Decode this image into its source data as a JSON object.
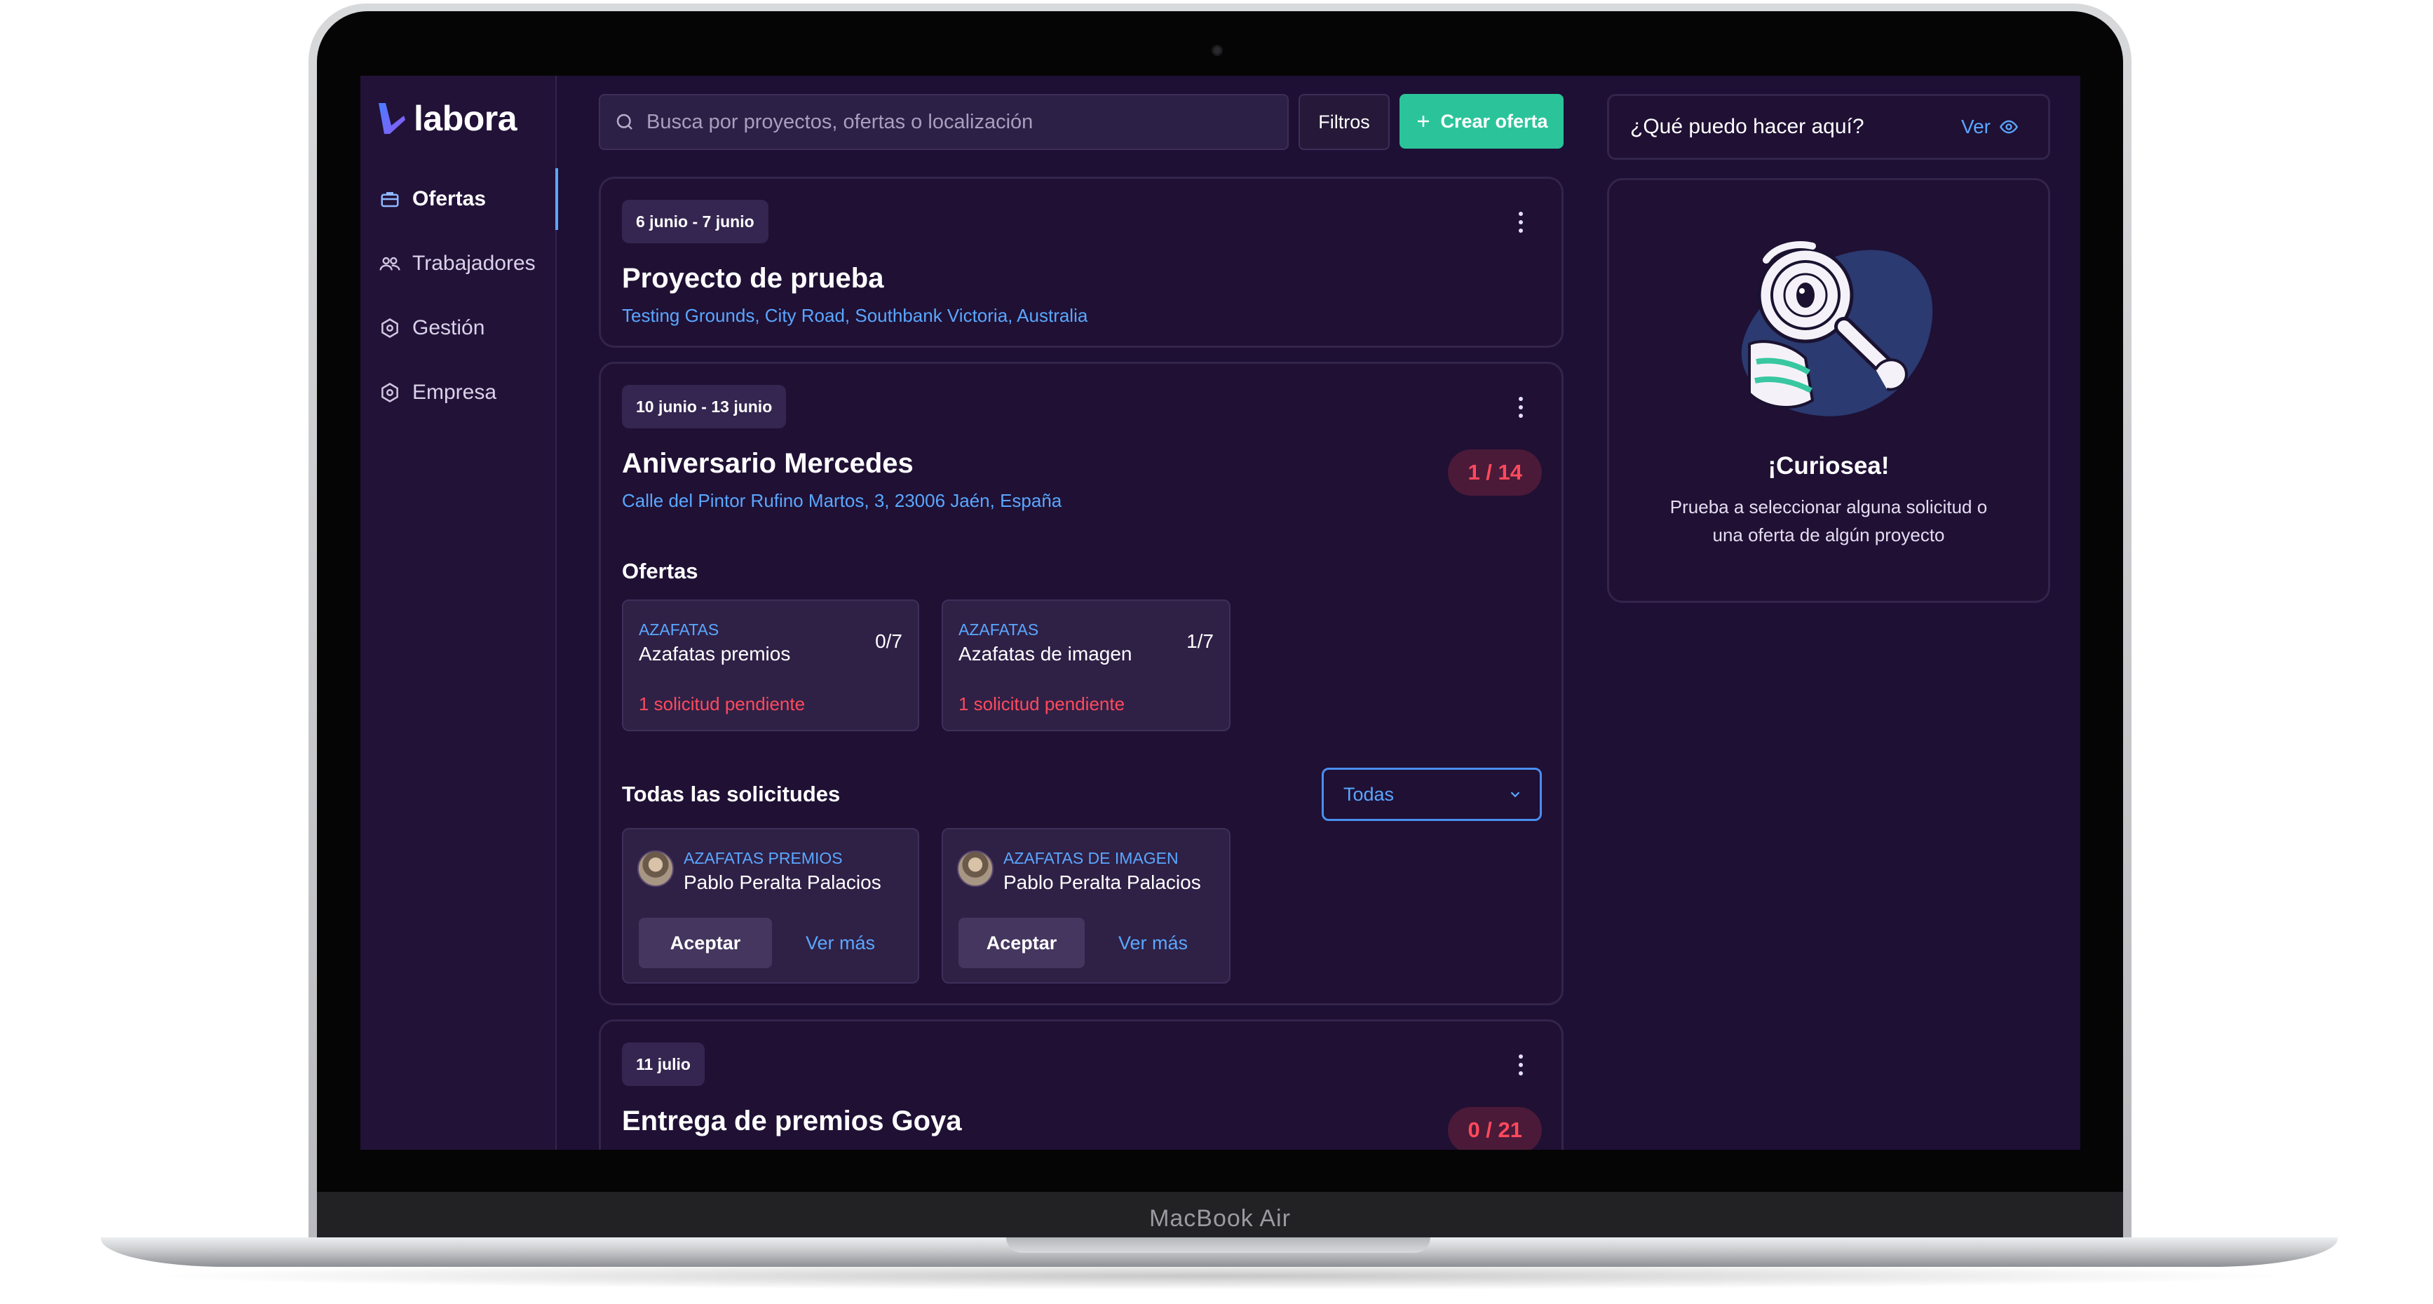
{
  "device": {
    "brand_label": "MacBook Air"
  },
  "app": {
    "logo_text": "labora"
  },
  "sidebar": {
    "items": [
      {
        "label": "Ofertas",
        "icon": "briefcase-icon",
        "active": true
      },
      {
        "label": "Trabajadores",
        "icon": "users-icon",
        "active": false
      },
      {
        "label": "Gestión",
        "icon": "gear-icon",
        "active": false
      },
      {
        "label": "Empresa",
        "icon": "gear-icon",
        "active": false
      }
    ]
  },
  "toolbar": {
    "search_placeholder": "Busca por proyectos, ofertas o localización",
    "filters_label": "Filtros",
    "create_label": "Crear oferta"
  },
  "projects": [
    {
      "date": "6 junio - 7 junio",
      "title": "Proyecto de prueba",
      "location": "Testing Grounds, City Road, Southbank Victoria, Australia"
    },
    {
      "date": "10 junio - 13 junio",
      "title": "Aniversario Mercedes",
      "location": "Calle del Pintor Rufino Martos, 3, 23006 Jaén, España",
      "count": "1 / 14",
      "offers_title": "Ofertas",
      "offers": [
        {
          "category": "AZAFATAS",
          "name": "Azafatas premios",
          "count": "0/7",
          "pending": "1 solicitud pendiente"
        },
        {
          "category": "AZAFATAS",
          "name": "Azafatas de imagen",
          "count": "1/7",
          "pending": "1 solicitud pendiente"
        }
      ],
      "requests_title": "Todas las solicitudes",
      "filter_value": "Todas",
      "requests": [
        {
          "category": "AZAFATAS PREMIOS",
          "name": "Pablo Peralta Palacios",
          "accept": "Aceptar",
          "more": "Ver más"
        },
        {
          "category": "AZAFATAS DE IMAGEN",
          "name": "Pablo Peralta Palacios",
          "accept": "Aceptar",
          "more": "Ver más"
        }
      ]
    },
    {
      "date": "11 julio",
      "title": "Entrega de premios Goya",
      "count": "0 / 21"
    }
  ],
  "help": {
    "question": "¿Qué puedo hacer aquí?",
    "link": "Ver",
    "card_title": "¡Curiosea!",
    "card_text": "Prueba a seleccionar alguna solicitud o una oferta de algún proyecto"
  },
  "colors": {
    "background": "#1e0f35",
    "accent_green": "#2bc49a",
    "link_blue": "#5aa7ff",
    "alert_red": "#ff4a5c"
  }
}
